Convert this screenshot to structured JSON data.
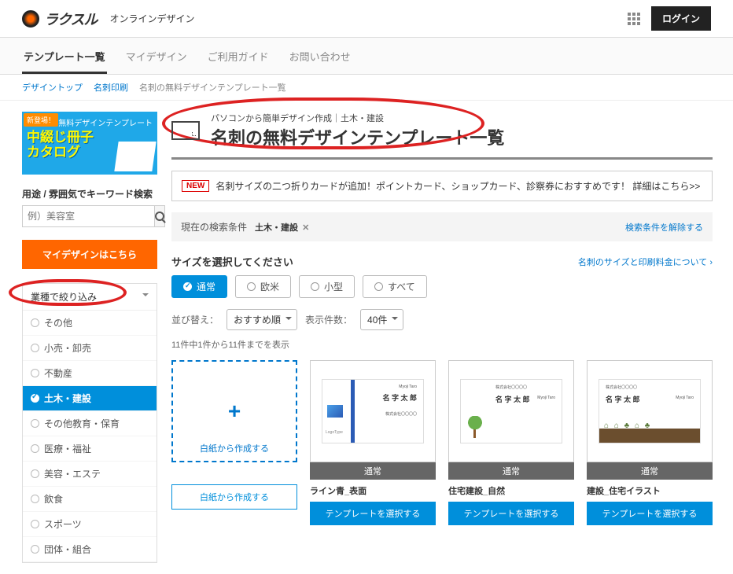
{
  "header": {
    "brand": "ラクスル",
    "subtitle": "オンラインデザイン",
    "login": "ログイン"
  },
  "nav": {
    "items": [
      "テンプレート一覧",
      "マイデザイン",
      "ご利用ガイド",
      "お問い合わせ"
    ],
    "active": 0
  },
  "breadcrumb": {
    "items": [
      "デザイントップ",
      "名刺印刷",
      "名刺の無料デザインテンプレート一覧"
    ]
  },
  "promo": {
    "badge": "新登場！",
    "sub": "無料デザインテンプレート",
    "line1": "中綴じ冊子",
    "line2": "カタログ"
  },
  "sidebar": {
    "search_label": "用途 / 雰囲気でキーワード検索",
    "search_placeholder": "例）美容室",
    "mydesign": "マイデザインはこちら",
    "filter_head": "業種で絞り込み",
    "filters": [
      "その他",
      "小売・卸売",
      "不動産",
      "土木・建設",
      "その他教育・保育",
      "医療・福祉",
      "美容・エステ",
      "飲食",
      "スポーツ",
      "団体・組合"
    ],
    "selected": 3
  },
  "title": {
    "super": "パソコンから簡単デザイン作成｜土木・建設",
    "main": "名刺の無料デザインテンプレート一覧"
  },
  "notice": {
    "badge": "NEW",
    "text": "名刺サイズの二つ折りカードが追加！ポイントカード、ショップカード、診察券におすすめです！ 詳細はこちら>>"
  },
  "cond": {
    "label": "現在の検索条件",
    "tag": "土木・建設",
    "clear": "検索条件を解除する"
  },
  "size": {
    "label": "サイズを選択してください",
    "link": "名刺のサイズと印刷料金について",
    "opts": [
      "通常",
      "欧米",
      "小型",
      "すべて"
    ],
    "selected": 0
  },
  "sort": {
    "label": "並び替え：",
    "value": "おすすめ順",
    "count_label": "表示件数：",
    "count_value": "40件"
  },
  "result_count": "11件中1件から11件までを表示",
  "cards": {
    "blank_caption": "白紙から作成する",
    "blank_btn": "白紙から作成する",
    "select_btn": "テンプレートを選択する",
    "size_badge": "通常",
    "sample_name": "名 字 太 郎",
    "sample_name_en": "Myoji Taro",
    "sample_company": "株式会社〇〇〇〇",
    "logo_text": "LogoType",
    "items": [
      {
        "title": "ライン青_表面"
      },
      {
        "title": "住宅建設_自然"
      },
      {
        "title": "建設_住宅イラスト"
      }
    ]
  }
}
